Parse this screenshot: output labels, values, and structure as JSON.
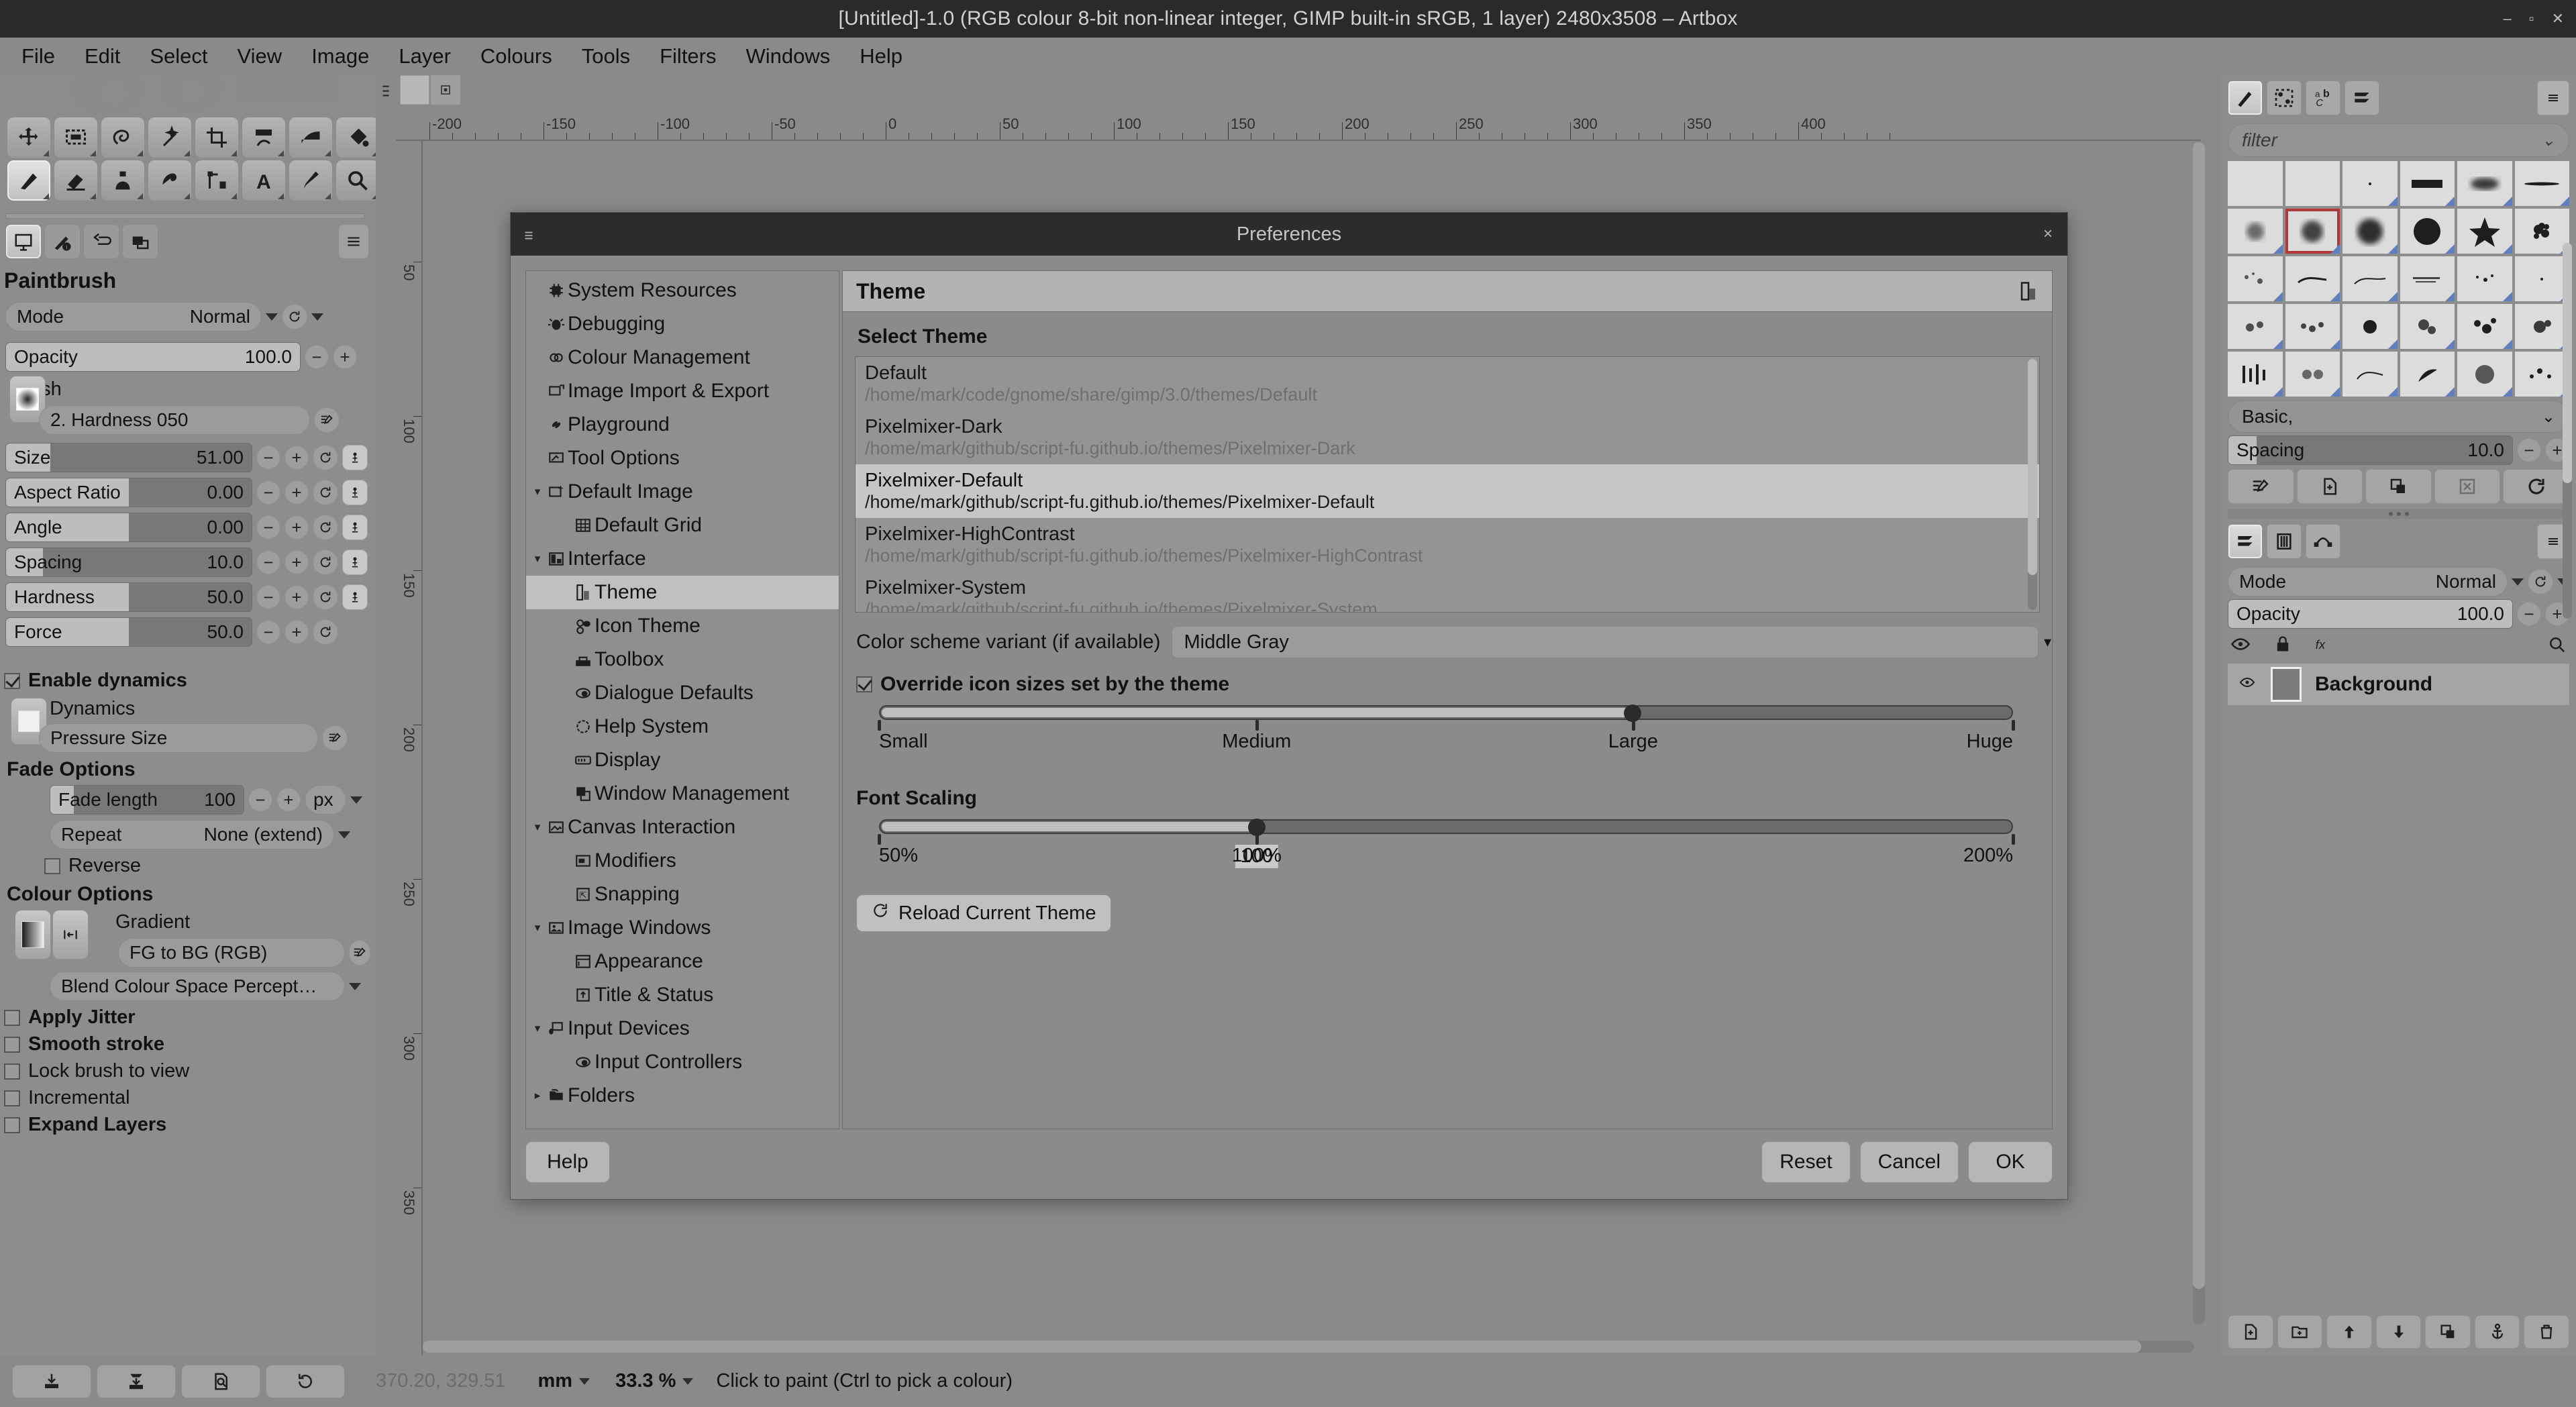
{
  "window": {
    "title": "[Untitled]-1.0 (RGB colour 8-bit non-linear integer, GIMP built-in sRGB, 1 layer) 2480x3508 – Artbox",
    "minimize": "–",
    "maximize": "▫",
    "close": "✕"
  },
  "menubar": [
    "File",
    "Edit",
    "Select",
    "View",
    "Image",
    "Layer",
    "Colours",
    "Tools",
    "Filters",
    "Windows",
    "Help"
  ],
  "toolbox": {
    "title": "Paintbrush",
    "mode": {
      "label": "Mode",
      "value": "Normal"
    },
    "opacity": {
      "label": "Opacity",
      "value": "100.0"
    },
    "brush": {
      "label": "Brush",
      "value": "2. Hardness 050"
    },
    "sliders": [
      {
        "label": "Size",
        "value": "51.00",
        "fill": 18
      },
      {
        "label": "Aspect Ratio",
        "value": "0.00",
        "fill": 50
      },
      {
        "label": "Angle",
        "value": "0.00",
        "fill": 50
      },
      {
        "label": "Spacing",
        "value": "10.0",
        "fill": 15
      },
      {
        "label": "Hardness",
        "value": "50.0",
        "fill": 50
      },
      {
        "label": "Force",
        "value": "50.0",
        "fill": 50
      }
    ],
    "enable_dynamics": "Enable dynamics",
    "dynamics": {
      "label": "Dynamics",
      "value": "Pressure Size"
    },
    "fade_options": "Fade Options",
    "fade_length": {
      "label": "Fade length",
      "value": "100",
      "unit": "px"
    },
    "repeat": {
      "label": "Repeat",
      "value": "None (extend)"
    },
    "reverse": "Reverse",
    "colour_options": "Colour Options",
    "gradient": {
      "label": "Gradient",
      "value": "FG to BG (RGB)"
    },
    "blend_space": "Blend Colour Space Percept…",
    "checkboxes": [
      "Apply Jitter",
      "Smooth stroke",
      "Lock brush to view",
      "Incremental",
      "Expand Layers"
    ]
  },
  "rulers": {
    "horizontal": [
      "-200",
      "-150",
      "-100",
      "-50",
      "0",
      "50",
      "100",
      "150",
      "200",
      "250",
      "300",
      "350",
      "400"
    ],
    "vertical": [
      "50",
      "100",
      "150",
      "200",
      "250",
      "300",
      "350"
    ]
  },
  "preferences": {
    "title": "Preferences",
    "close": "×",
    "tree": [
      {
        "label": "System Resources",
        "icon": "chip-icon",
        "depth": 1,
        "expander": "",
        "selected": false
      },
      {
        "label": "Debugging",
        "icon": "bug-icon",
        "depth": 1,
        "expander": "",
        "selected": false
      },
      {
        "label": "Colour Management",
        "icon": "colour-circles-icon",
        "depth": 1,
        "expander": "",
        "selected": false
      },
      {
        "label": "Image Import & Export",
        "icon": "import-export-icon",
        "depth": 1,
        "expander": "",
        "selected": false
      },
      {
        "label": "Playground",
        "icon": "playground-icon",
        "depth": 1,
        "expander": "",
        "selected": false
      },
      {
        "label": "Tool Options",
        "icon": "tool-options-icon",
        "depth": 1,
        "expander": "",
        "selected": false
      },
      {
        "label": "Default Image",
        "icon": "default-image-icon",
        "depth": 1,
        "expander": "▾",
        "selected": false
      },
      {
        "label": "Default Grid",
        "icon": "grid-icon",
        "depth": 2,
        "expander": "",
        "selected": false
      },
      {
        "label": "Interface",
        "icon": "interface-icon",
        "depth": 1,
        "expander": "▾",
        "selected": false
      },
      {
        "label": "Theme",
        "icon": "theme-icon",
        "depth": 2,
        "expander": "",
        "selected": true
      },
      {
        "label": "Icon Theme",
        "icon": "icon-theme-icon",
        "depth": 2,
        "expander": "",
        "selected": false
      },
      {
        "label": "Toolbox",
        "icon": "toolbox-icon",
        "depth": 2,
        "expander": "",
        "selected": false
      },
      {
        "label": "Dialogue Defaults",
        "icon": "dialogue-icon",
        "depth": 2,
        "expander": "",
        "selected": false
      },
      {
        "label": "Help System",
        "icon": "help-icon",
        "depth": 2,
        "expander": "",
        "selected": false
      },
      {
        "label": "Display",
        "icon": "display-icon",
        "depth": 2,
        "expander": "",
        "selected": false
      },
      {
        "label": "Window Management",
        "icon": "window-management-icon",
        "depth": 2,
        "expander": "",
        "selected": false
      },
      {
        "label": "Canvas Interaction",
        "icon": "canvas-icon",
        "depth": 1,
        "expander": "▾",
        "selected": false
      },
      {
        "label": "Modifiers",
        "icon": "modifiers-icon",
        "depth": 2,
        "expander": "",
        "selected": false
      },
      {
        "label": "Snapping",
        "icon": "snapping-icon",
        "depth": 2,
        "expander": "",
        "selected": false
      },
      {
        "label": "Image Windows",
        "icon": "image-windows-icon",
        "depth": 1,
        "expander": "▾",
        "selected": false
      },
      {
        "label": "Appearance",
        "icon": "appearance-icon",
        "depth": 2,
        "expander": "",
        "selected": false
      },
      {
        "label": "Title & Status",
        "icon": "title-status-icon",
        "depth": 2,
        "expander": "",
        "selected": false
      },
      {
        "label": "Input Devices",
        "icon": "input-devices-icon",
        "depth": 1,
        "expander": "▾",
        "selected": false
      },
      {
        "label": "Input Controllers",
        "icon": "input-controllers-icon",
        "depth": 2,
        "expander": "",
        "selected": false
      },
      {
        "label": "Folders",
        "icon": "folders-icon",
        "depth": 1,
        "expander": "▸",
        "selected": false
      }
    ],
    "pane_title": "Theme",
    "select_theme_label": "Select Theme",
    "themes": [
      {
        "name": "Default",
        "path": "/home/mark/code/gnome/share/gimp/3.0/themes/Default",
        "selected": false
      },
      {
        "name": "Pixelmixer-Dark",
        "path": "/home/mark/github/script-fu.github.io/themes/Pixelmixer-Dark",
        "selected": false
      },
      {
        "name": "Pixelmixer-Default",
        "path": "/home/mark/github/script-fu.github.io/themes/Pixelmixer-Default",
        "selected": true
      },
      {
        "name": "Pixelmixer-HighContrast",
        "path": "/home/mark/github/script-fu.github.io/themes/Pixelmixer-HighContrast",
        "selected": false
      },
      {
        "name": "Pixelmixer-System",
        "path": "/home/mark/github/script-fu.github.io/themes/Pixelmixer-System",
        "selected": false
      }
    ],
    "variant_label": "Color scheme variant (if available)",
    "variant_value": "Middle Gray",
    "override_icon_sizes": "Override icon sizes set by the theme",
    "icon_size_ticks": [
      "Small",
      "Medium",
      "Large",
      "Huge"
    ],
    "icon_size_value_pct": 66.5,
    "font_scaling_label": "Font Scaling",
    "font_scale_ticks": [
      "50%",
      "100%",
      "200%"
    ],
    "font_scale_value_pct": 33.3,
    "font_scale_value": "100",
    "reload_button": "Reload Current Theme",
    "buttons": {
      "help": "Help",
      "reset": "Reset",
      "cancel": "Cancel",
      "ok": "OK"
    }
  },
  "dock": {
    "filter_placeholder": "filter",
    "brush_set": "Basic,",
    "spacing": {
      "label": "Spacing",
      "value": "10.0"
    },
    "mode": {
      "label": "Mode",
      "value": "Normal"
    },
    "opacity": {
      "label": "Opacity",
      "value": "100.0"
    },
    "layer": {
      "name": "Background"
    }
  },
  "statusbar": {
    "coords": "370.20, 329.51",
    "unit": "mm",
    "zoom": "33.3 %",
    "hint": "Click to paint (Ctrl to pick a colour)"
  }
}
